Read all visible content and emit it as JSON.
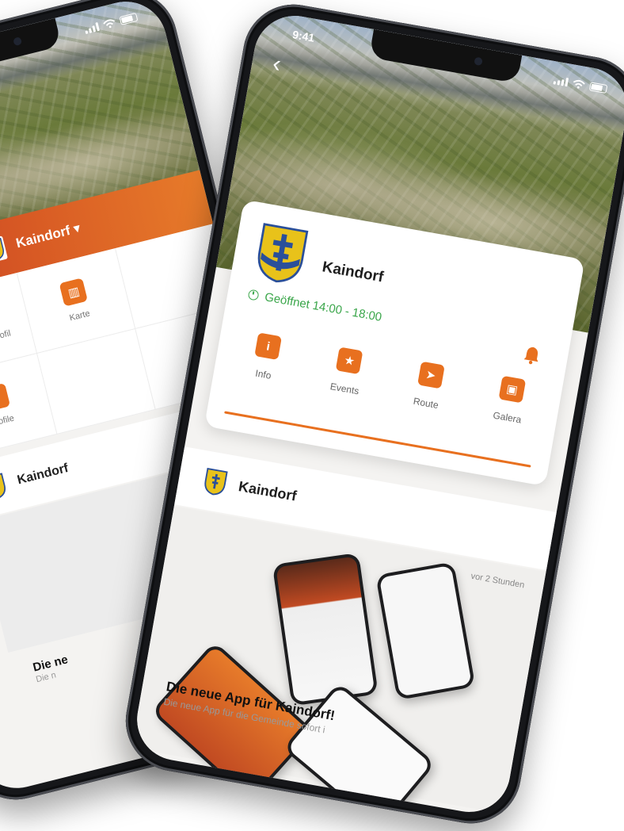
{
  "back_phone": {
    "header": {
      "title": "Kaindorf"
    },
    "tiles": [
      {
        "label": "Gemeindeprofil",
        "icon": "bell-desk-icon"
      },
      {
        "label": "Karte",
        "icon": "map-icon"
      },
      {
        "label": "",
        "icon": ""
      },
      {
        "label": "Profile",
        "icon": "flag-icon"
      },
      {
        "label": "",
        "icon": ""
      },
      {
        "label": "",
        "icon": ""
      }
    ],
    "feed": {
      "name": "Kaindorf",
      "post_title": "Die ne",
      "post_sub": "Die n"
    }
  },
  "front_phone": {
    "status": {
      "time": "9:41"
    },
    "card": {
      "name": "Kaindorf",
      "hours": "Geöffnet 14:00 - 18:00"
    },
    "actions": [
      {
        "label": "Info",
        "icon": "info-icon"
      },
      {
        "label": "Events",
        "icon": "calendar-star-icon"
      },
      {
        "label": "Route",
        "icon": "navigation-icon"
      },
      {
        "label": "Galera",
        "icon": "gallery-icon"
      }
    ],
    "feed": {
      "name": "Kaindorf",
      "time": "vor 2 Stunden",
      "post_title": "Die neue App für Kaindorf!",
      "post_sub": "Die neue App für die Gemeinde sofort i"
    }
  },
  "colors": {
    "accent": "#e8701f",
    "open_green": "#3aa64a",
    "band_red": "#c23a22"
  }
}
